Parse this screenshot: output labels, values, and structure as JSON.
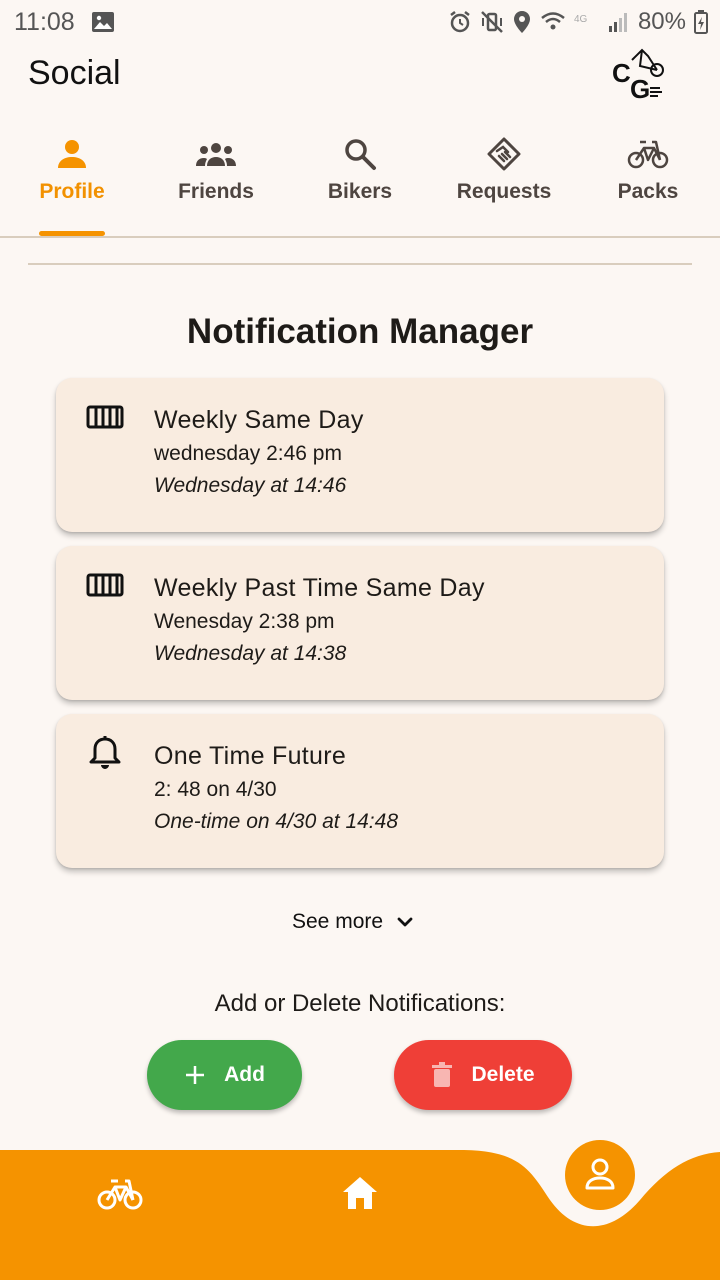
{
  "status_bar": {
    "time": "11:08",
    "battery": "80%"
  },
  "app_bar": {
    "title": "Social",
    "logo_icon": "cg-bike-logo"
  },
  "tabs": [
    {
      "label": "Profile",
      "icon": "person-icon",
      "active": true
    },
    {
      "label": "Friends",
      "icon": "group-icon",
      "active": false
    },
    {
      "label": "Bikers",
      "icon": "search-icon",
      "active": false
    },
    {
      "label": "Requests",
      "icon": "handshake-icon",
      "active": false
    },
    {
      "label": "Packs",
      "icon": "bicycle-icon",
      "active": false
    }
  ],
  "main": {
    "heading": "Notification Manager",
    "notifications": [
      {
        "icon": "weekly-calendar-icon",
        "title": "Weekly Same Day",
        "subtitle": "wednesday 2:46 pm",
        "description": "Wednesday at 14:46"
      },
      {
        "icon": "weekly-calendar-icon",
        "title": "Weekly Past Time Same Day",
        "subtitle": "Wenesday 2:38 pm",
        "description": "Wednesday at 14:38"
      },
      {
        "icon": "bell-icon",
        "title": "One Time Future",
        "subtitle": "2: 48 on 4/30",
        "description": "One-time on 4/30 at 14:48"
      }
    ],
    "see_more_label": "See more",
    "add_delete_label": "Add or Delete Notifications:",
    "add_label": "Add",
    "delete_label": "Delete"
  },
  "bottom_nav": {
    "items": [
      {
        "icon": "bicycle-icon",
        "active": false
      },
      {
        "icon": "home-icon",
        "active": false
      },
      {
        "icon": "person-icon",
        "active": true
      }
    ]
  },
  "colors": {
    "accent": "#f59300",
    "background": "#fcf7f3",
    "card": "#f9ece0",
    "add_button": "#43a84b",
    "delete_button": "#ef3f37"
  }
}
